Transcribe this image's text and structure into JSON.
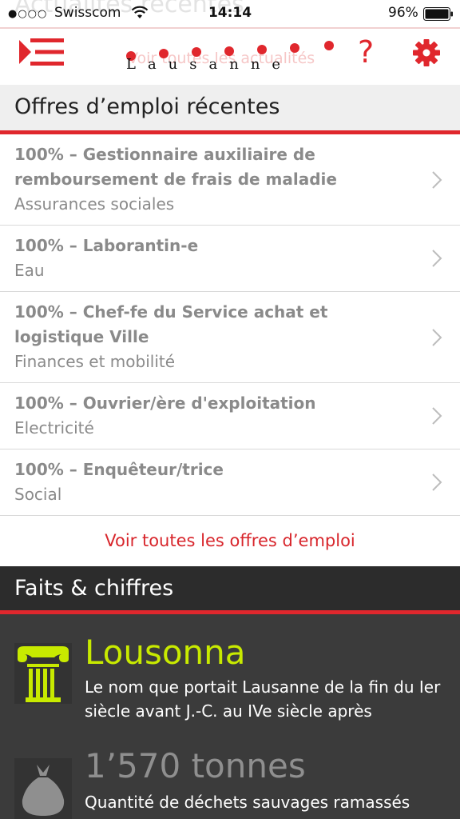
{
  "status_bar": {
    "signal": "●○○○",
    "carrier": "Swisscom",
    "time": "14:14",
    "battery": "96%"
  },
  "background_header": {
    "title": "Actualités récentes",
    "subtitle": "Voir toutes les actualités"
  },
  "header": {
    "logo_text": "Lausanne",
    "help_symbol": "?",
    "menu_icon": "menu-icon",
    "settings_icon": "gear-icon",
    "accent_color": "#e0272d"
  },
  "jobs_section": {
    "title": "Offres d’emploi récentes",
    "items": [
      {
        "title": "100% – Gestionnaire auxiliaire de remboursement de frais de maladie",
        "department": "Assurances sociales"
      },
      {
        "title": "100% – Laborantin-e",
        "department": "Eau"
      },
      {
        "title": "100% – Chef-fe du Service achat et logistique Ville",
        "department": "Finances et mobilité"
      },
      {
        "title": "100% – Ouvrier/ère d'exploitation",
        "department": "Electricité"
      },
      {
        "title": "100% – Enquêteur/trice",
        "department": "Social"
      }
    ],
    "see_all": "Voir toutes les offres d’emploi"
  },
  "facts_section": {
    "title": "Faits & chiffres",
    "items": [
      {
        "value": "Lousonna",
        "description": "Le nom que portait Lausanne de la fin du Ier siècle avant J.-C. au IVe siècle après",
        "icon": "column-icon",
        "color": "#c8ea00"
      },
      {
        "value": "1’570 tonnes",
        "description": "Quantité de déchets sauvages ramassés",
        "icon": "trash-bag-icon",
        "color": "#8f8f8f"
      }
    ]
  }
}
